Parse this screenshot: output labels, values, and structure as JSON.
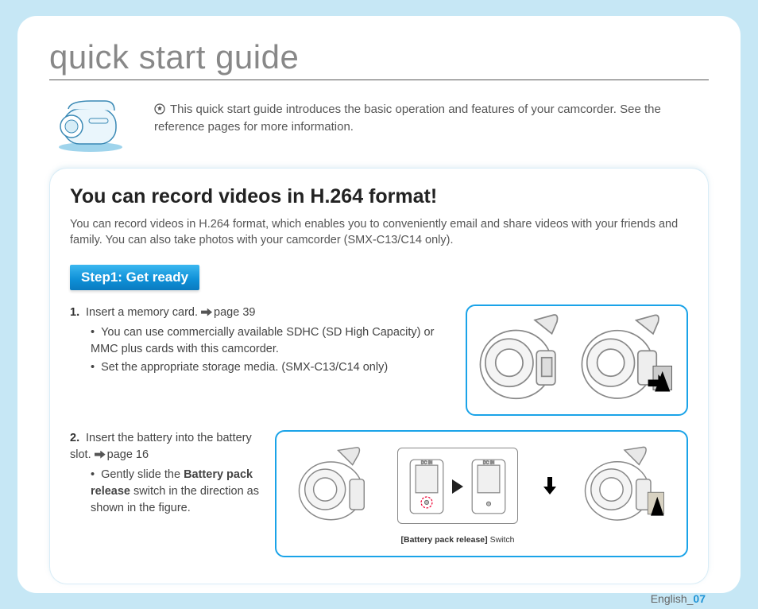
{
  "title": "quick start guide",
  "intro": "This quick start guide introduces the basic operation and features of your camcorder. See the reference pages for more information.",
  "section": {
    "heading": "You can record videos in H.264 format!",
    "desc": "You can record videos in H.264 format, which enables you to conveniently email and share videos with your friends and family. You can also take photos with your camcorder (SMX-C13/C14 only)."
  },
  "step_tab": "Step1:  Get ready",
  "item1": {
    "num": "1.",
    "main": "Insert a memory card. ",
    "pageref": "page 39",
    "bullets": [
      "You can use commercially available SDHC (SD High Capacity) or MMC plus cards with this camcorder.",
      "Set the appropriate storage media. (SMX-C13/C14 only)"
    ]
  },
  "item2": {
    "num": "2.",
    "main": "Insert the battery into the battery slot. ",
    "pageref": "page 16",
    "bullet_prefix": "Gently slide the ",
    "bullet_bold": "Battery pack release",
    "bullet_suffix": " switch in the direction as shown in the figure."
  },
  "caption2_bold": "[Battery pack release]",
  "caption2_rest": " Switch",
  "footer_lang": "English_",
  "footer_page": "07"
}
